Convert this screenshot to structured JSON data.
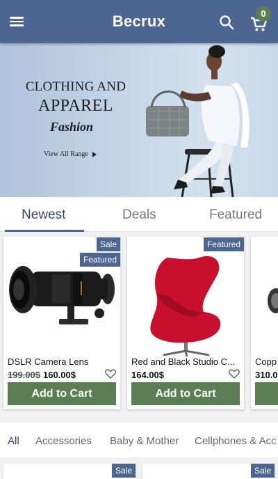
{
  "header": {
    "title": "Becrux",
    "cart_count": "0"
  },
  "banner": {
    "line1": "CLOTHING AND",
    "line2": "APPAREL",
    "line3": "Fashion",
    "link_label": "View All Range"
  },
  "tabs": [
    {
      "label": "Newest"
    },
    {
      "label": "Deals"
    },
    {
      "label": "Featured"
    }
  ],
  "products": [
    {
      "badges": [
        "Sale",
        "Featured"
      ],
      "name": "DSLR Camera Lens",
      "old_price": "199.00$",
      "price": "160.00$",
      "button": "Add to Cart"
    },
    {
      "badges": [
        "Featured"
      ],
      "name": "Red and Black Studio C...",
      "old_price": "",
      "price": "164.00$",
      "button": "Add to Cart"
    },
    {
      "badges": [],
      "name": "Copp",
      "old_price": "",
      "price": "310.0",
      "button": ""
    }
  ],
  "categories": [
    {
      "label": "All"
    },
    {
      "label": "Accessories"
    },
    {
      "label": "Baby & Mother"
    },
    {
      "label": "Cellphones & Acc"
    }
  ],
  "next_row": {
    "badges": [
      "Sale",
      "Sale"
    ]
  },
  "colors": {
    "primary": "#4d6691",
    "accent_green": "#5b7d54",
    "badge_green": "#5a7d51"
  }
}
